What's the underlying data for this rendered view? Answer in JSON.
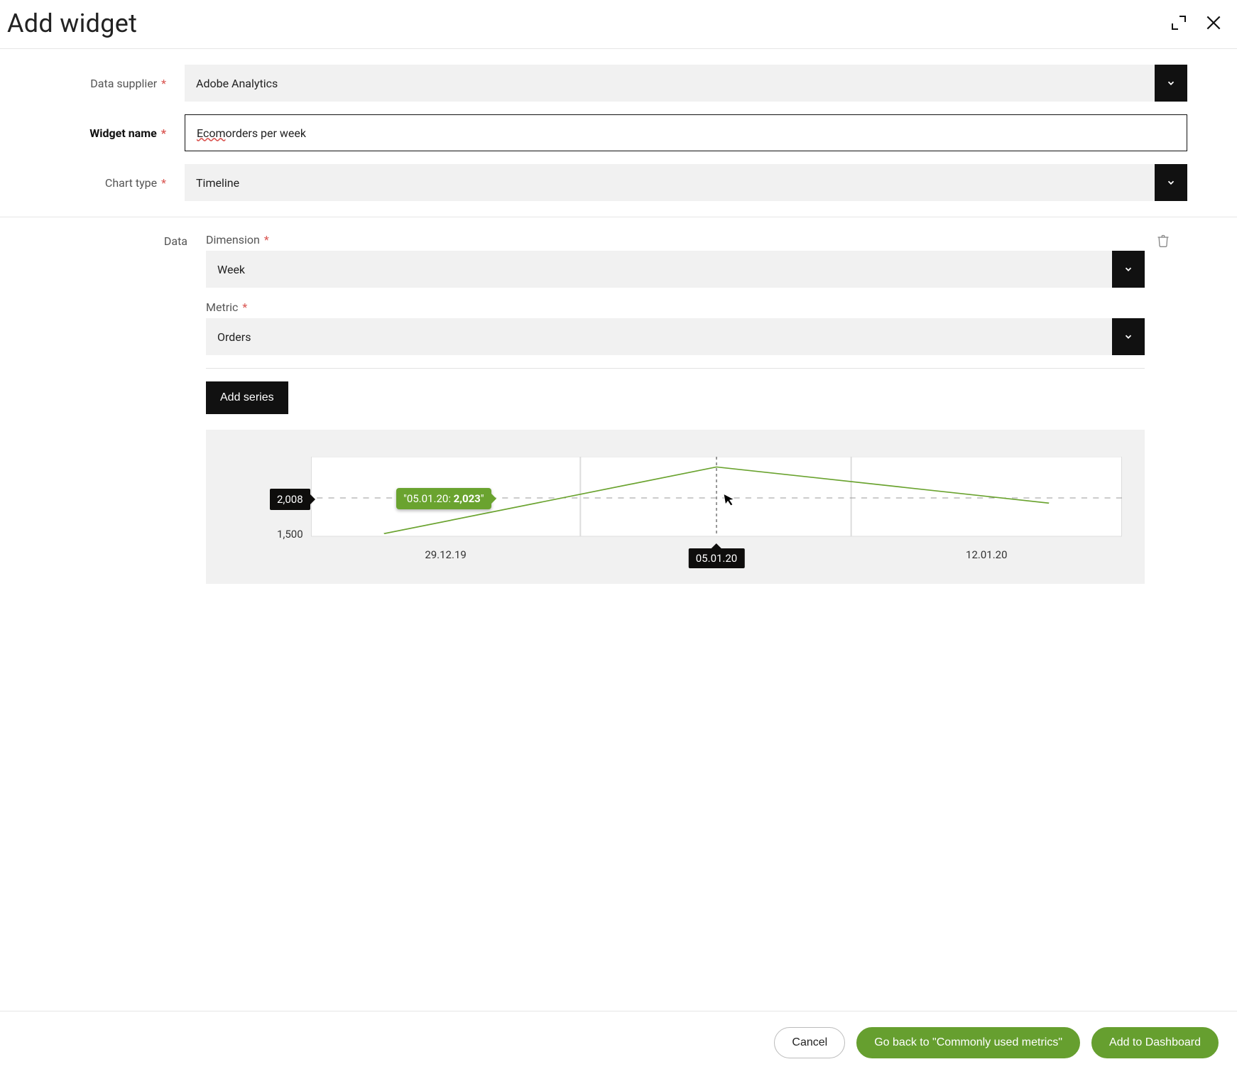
{
  "header": {
    "title": "Add widget"
  },
  "form": {
    "data_supplier_label": "Data supplier",
    "data_supplier_value": "Adobe Analytics",
    "widget_name_label": "Widget name",
    "widget_name_prefix": "Ecom",
    "widget_name_suffix": " orders per week",
    "chart_type_label": "Chart type",
    "chart_type_value": "Timeline"
  },
  "data_section": {
    "label": "Data",
    "dimension_label": "Dimension",
    "dimension_value": "Week",
    "metric_label": "Metric",
    "metric_value": "Orders",
    "add_series_label": "Add series"
  },
  "chart_data": {
    "type": "line",
    "y_hover_value": "2,008",
    "y_tick": "1,500",
    "categories": [
      "29.12.19",
      "05.01.20",
      "12.01.20"
    ],
    "values": [
      1520,
      2023,
      1750
    ],
    "hover_index": 1,
    "tooltip_date": "05.01.20",
    "tooltip_value": "2,023",
    "ylim": [
      1500,
      2100
    ],
    "xlabel": "",
    "ylabel": "",
    "series_color": "#6aa32f"
  },
  "footer": {
    "cancel": "Cancel",
    "go_back": "Go back to \"Commonly used metrics\"",
    "add": "Add to Dashboard"
  }
}
